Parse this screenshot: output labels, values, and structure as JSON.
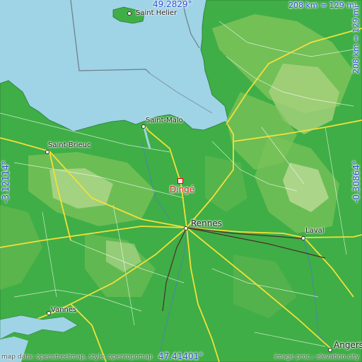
{
  "map": {
    "main_place": "Dingé",
    "coords": {
      "top": "49.2829°",
      "bottom": "47.41401°",
      "left": "-3.12114°",
      "right": "-0.30864°"
    },
    "scale": {
      "horizontal": "208 km = 129 mi",
      "vertical": "208 km = 129 mi"
    },
    "places": {
      "saint_helier": "Saint Helier",
      "saint_malo": "Saint-Malo",
      "saint_brieuc": "Saint-Brieuc",
      "rennes": "Rennes",
      "laval": "Laval",
      "vannes": "Vannes",
      "angers": "Angers"
    },
    "credits": {
      "left": "map data: openstreetmap, style: opentopomap",
      "right": "image proc.: elevation.city"
    },
    "colors": {
      "sea": "#9fd3e6",
      "lowland": "#3fae46",
      "upland": "#7cc35a",
      "highland": "#c8e0a0",
      "road_major": "#f3e03a",
      "marker": "#e02020",
      "coord_text": "#2d4fd6"
    }
  }
}
